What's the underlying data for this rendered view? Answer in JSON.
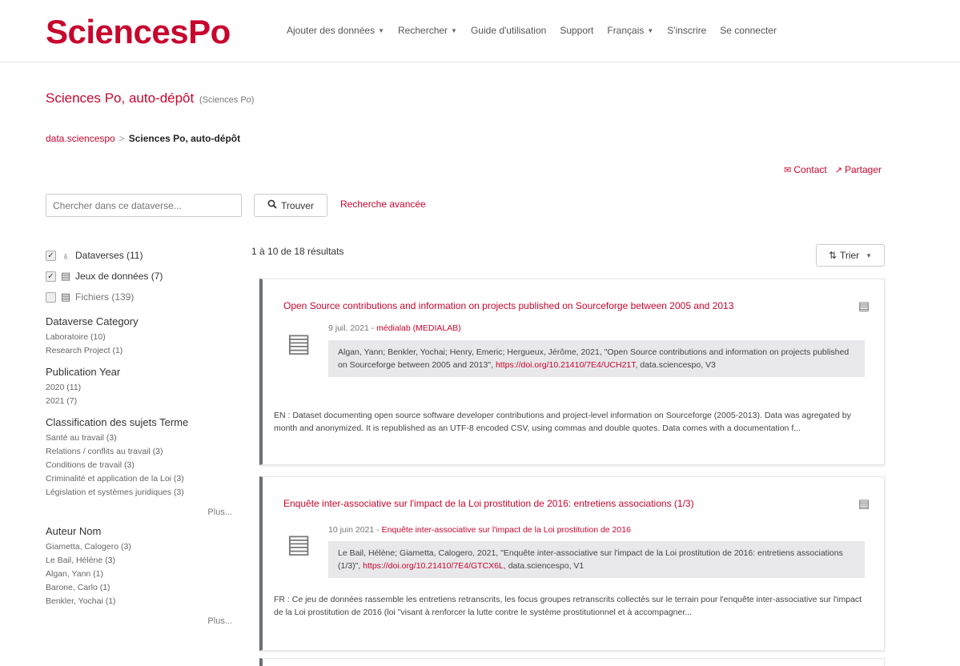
{
  "brand": {
    "logo": "SciencesPo",
    "accent": "#c7062e"
  },
  "nav": {
    "add_data": "Ajouter des données",
    "search": "Rechercher",
    "guide": "Guide d'utilisation",
    "support": "Support",
    "language": "Français",
    "signup": "S'inscrire",
    "login": "Se connecter"
  },
  "dataverse": {
    "title": "Sciences Po, auto-dépôt",
    "affiliation": "(Sciences Po)"
  },
  "breadcrumb": {
    "root": "data.sciencespo",
    "separator": ">",
    "current": "Sciences Po, auto-dépôt"
  },
  "actions": {
    "contact": "Contact",
    "share": "Partager"
  },
  "search": {
    "placeholder": "Chercher dans ce dataverse...",
    "button": "Trouver",
    "advanced": "Recherche avancée"
  },
  "types": [
    {
      "label": "Dataverses (11)",
      "checked": true
    },
    {
      "label": "Jeux de données (7)",
      "checked": true
    },
    {
      "label": "Fichiers (139)",
      "checked": false
    }
  ],
  "facets": {
    "category": {
      "title": "Dataverse Category",
      "items": [
        "Laboratoire (10)",
        "Research Project (1)"
      ]
    },
    "year": {
      "title": "Publication Year",
      "items": [
        "2020 (11)",
        "2021 (7)"
      ]
    },
    "subject": {
      "title": "Classification des sujets Terme",
      "items": [
        "Santé au travail (3)",
        "Relations / conflits au travail (3)",
        "Conditions de travail (3)",
        "Criminalité et application de la Loi (3)",
        "Législation et systèmes juridiques (3)"
      ],
      "more": "Plus..."
    },
    "author": {
      "title": "Auteur Nom",
      "items": [
        "Giametta, Calogero (3)",
        "Le Bail, Hélène (3)",
        "Algan, Yann (1)",
        "Barone, Carlo (1)",
        "Benkler, Yochai (1)"
      ],
      "more": "Plus..."
    }
  },
  "results": {
    "count": "1 à 10 de 18 résultats",
    "sort": "Trier",
    "items": [
      {
        "title": "Open Source contributions and information on projects published on Sourceforge between 2005 and 2013",
        "date": "9 juil. 2021 - ",
        "source": "médialab (MEDIALAB)",
        "citation": "Algan, Yann; Benkler, Yochai; Henry, Emeric; Hergueux, Jérôme, 2021, \"Open Source contributions and information on projects published on Sourceforge between 2005 and 2013\", ",
        "doi": "https://doi.org/10.21410/7E4/UCH21T",
        "citation_end": ", data.sciencespo, V3",
        "description": "EN : Dataset documenting open source software developer contributions and project-level information on Sourceforge (2005-2013). Data was agregated by month and anonymized. It is republished as an UTF-8 encoded CSV, using commas and double quotes. Data comes with a documentation f..."
      },
      {
        "title": "Enquête inter-associative sur l'impact de la Loi prostitution de 2016: entretiens associations (1/3)",
        "date": "10 juin 2021 - ",
        "source": "Enquête inter-associative sur l'impact de la Loi prostitution de 2016",
        "citation": "Le Bail, Hélène; Giametta, Calogero, 2021, \"Enquête inter-associative sur l'impact de la Loi prostitution de 2016: entretiens associations (1/3)\", ",
        "doi": "https://doi.org/10.21410/7E4/GTCX6L",
        "citation_end": ", data.sciencespo, V1",
        "description": "FR : Ce jeu de données rassemble les entretiens retranscrits, les focus groupes retranscrits collectés sur le terrain pour l'enquête inter-associative sur l'impact de la Loi prostitution de 2016 (loi \"visant à renforcer la lutte contre le système prostitutionnel et à accompagner..."
      }
    ]
  }
}
